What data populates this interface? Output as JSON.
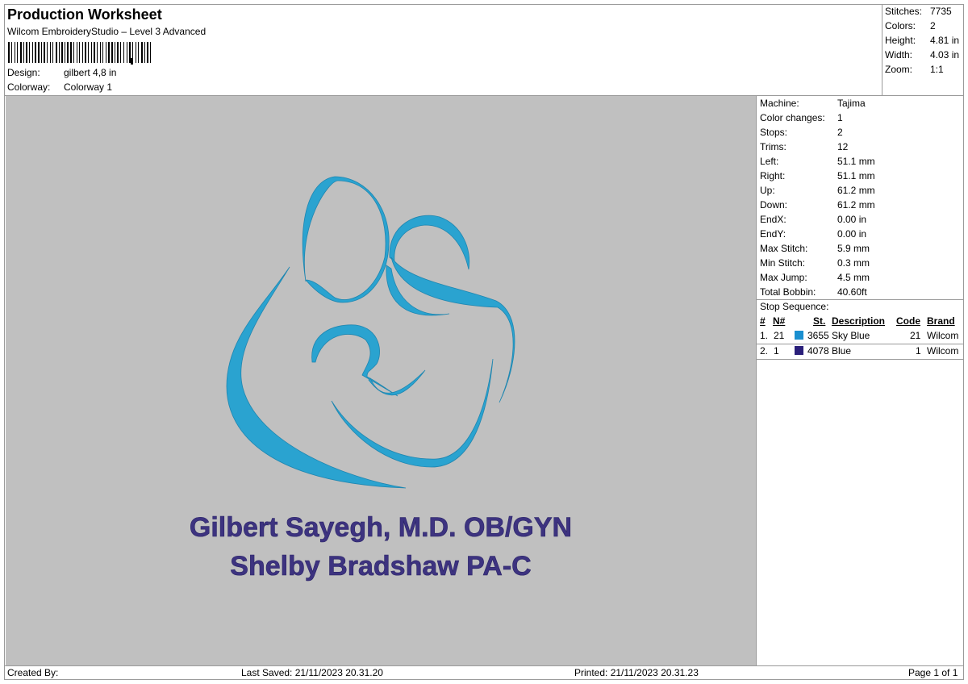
{
  "header": {
    "title": "Production Worksheet",
    "subtitle": "Wilcom EmbroideryStudio – Level 3 Advanced",
    "design_label": "Design:",
    "design_value": "gilbert 4,8 in",
    "colorway_label": "Colorway:",
    "colorway_value": "Colorway 1"
  },
  "summary": [
    {
      "label": "Stitches:",
      "value": "7735"
    },
    {
      "label": "Colors:",
      "value": "2"
    },
    {
      "label": "Height:",
      "value": "4.81 in"
    },
    {
      "label": "Width:",
      "value": "4.03 in"
    },
    {
      "label": "Zoom:",
      "value": "1:1"
    }
  ],
  "machine_info": [
    {
      "label": "Machine:",
      "value": "Tajima"
    },
    {
      "label": "Color changes:",
      "value": "1"
    },
    {
      "label": "Stops:",
      "value": "2"
    },
    {
      "label": "Trims:",
      "value": "12"
    },
    {
      "label": "Left:",
      "value": "51.1 mm"
    },
    {
      "label": "Right:",
      "value": "51.1 mm"
    },
    {
      "label": "Up:",
      "value": "61.2 mm"
    },
    {
      "label": "Down:",
      "value": "61.2 mm"
    },
    {
      "label": "EndX:",
      "value": "0.00 in"
    },
    {
      "label": "EndY:",
      "value": "0.00 in"
    },
    {
      "label": "Max Stitch:",
      "value": "5.9 mm"
    },
    {
      "label": "Min Stitch:",
      "value": "0.3 mm"
    },
    {
      "label": "Max Jump:",
      "value": "4.5 mm"
    },
    {
      "label": "Total Bobbin:",
      "value": "40.60ft"
    }
  ],
  "stop_sequence": {
    "title": "Stop Sequence:",
    "headers": {
      "num": "#",
      "n": "N#",
      "st": "St.",
      "description": "Description",
      "code": "Code",
      "brand": "Brand"
    },
    "rows": [
      {
        "num": "1.",
        "n": "21",
        "color": "#1a8fd0",
        "st": "3655",
        "description": "Sky Blue",
        "code": "21",
        "brand": "Wilcom"
      },
      {
        "num": "2.",
        "n": "1",
        "color": "#2a1f7a",
        "st": "4078",
        "description": "Blue",
        "code": "1",
        "brand": "Wilcom"
      }
    ]
  },
  "design_preview": {
    "line1": "Gilbert Sayegh, M.D. OB/GYN",
    "line2": "Shelby Bradshaw PA-C",
    "logo_color": "#2aa3d0",
    "text_color": "#3d3380",
    "background": "#c0c0c0"
  },
  "footer": {
    "created_by": "Created By:",
    "last_saved": "Last Saved: 21/11/2023 20.31.20",
    "printed": "Printed: 21/11/2023 20.31.23",
    "page": "Page 1 of 1"
  }
}
